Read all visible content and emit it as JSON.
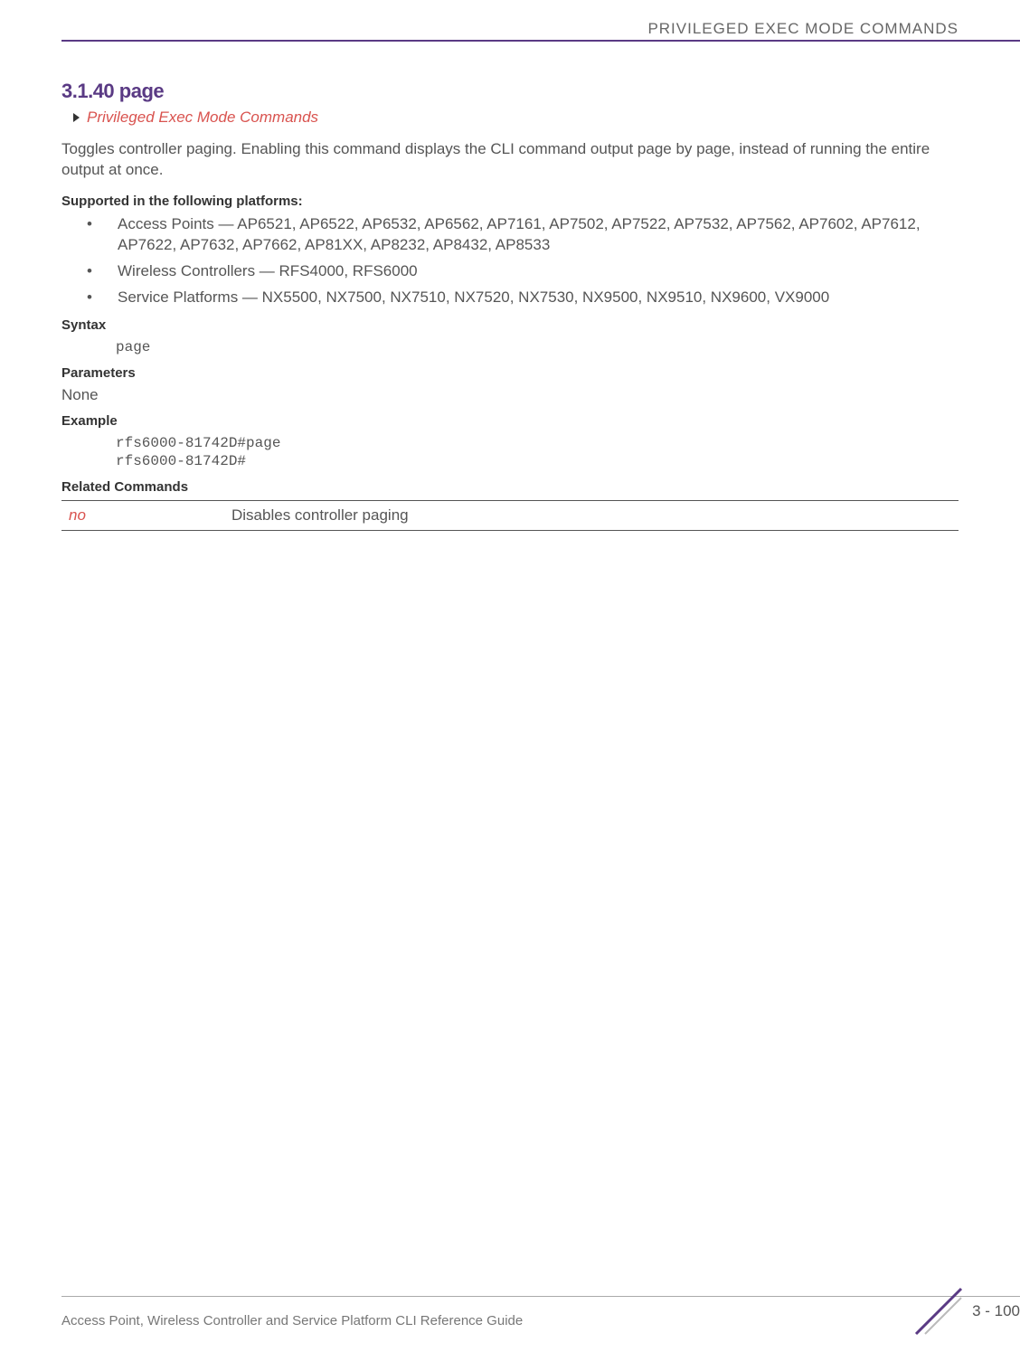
{
  "header": {
    "title": "PRIVILEGED EXEC MODE COMMANDS"
  },
  "section": {
    "title": "3.1.40 page",
    "breadcrumb": "Privileged Exec Mode Commands",
    "description": "Toggles controller paging. Enabling this command displays the CLI command output page by page, instead of running the entire output at once."
  },
  "supported": {
    "heading": "Supported in the following platforms:",
    "items": [
      "Access Points — AP6521, AP6522, AP6532, AP6562, AP7161, AP7502, AP7522, AP7532, AP7562, AP7602, AP7612, AP7622, AP7632, AP7662, AP81XX, AP8232, AP8432, AP8533",
      "Wireless Controllers — RFS4000, RFS6000",
      "Service Platforms — NX5500, NX7500, NX7510, NX7520, NX7530, NX9500, NX9510, NX9600, VX9000"
    ]
  },
  "syntax": {
    "heading": "Syntax",
    "code": "page"
  },
  "parameters": {
    "heading": "Parameters",
    "value": "None"
  },
  "example": {
    "heading": "Example",
    "code": "rfs6000-81742D#page\nrfs6000-81742D#"
  },
  "related": {
    "heading": "Related Commands",
    "rows": [
      {
        "cmd": "no",
        "desc": "Disables controller paging"
      }
    ]
  },
  "footer": {
    "text": "Access Point, Wireless Controller and Service Platform CLI Reference Guide",
    "page": "3 - 100"
  }
}
